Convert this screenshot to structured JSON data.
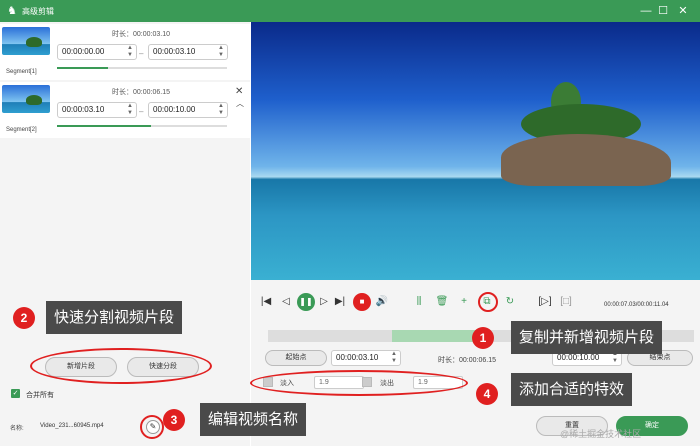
{
  "titlebar": {
    "title": "高级剪辑",
    "logo": "♞"
  },
  "window_controls": {
    "min": "—",
    "max": "☐",
    "close": "✕"
  },
  "segments": [
    {
      "label": "Segment[1]",
      "duration": "时长：00:00:03.10",
      "start": "00:00:00.00",
      "end": "00:00:03.10",
      "progress": 0.3
    },
    {
      "label": "Segment[2]",
      "duration": "时长：00:00:06.15",
      "start": "00:00:03.10",
      "end": "00:00:10.00",
      "progress": 0.55
    }
  ],
  "left_buttons": {
    "new_segment": "新增片段",
    "quick_split": "快速分段",
    "merge_all": "合并所有"
  },
  "file": {
    "name_label": "名称:",
    "name": "Video_231...60945.mp4"
  },
  "playback": {
    "time": "00:00:07.03/00:00:11.04"
  },
  "trim": {
    "start_label": "起始点",
    "start_value": "00:00:03.10",
    "duration": "时长：00:00:06.15",
    "end_value": "00:00:10.00",
    "end_label": "结束点"
  },
  "effects": {
    "fade_in": "淡入",
    "fade_in_value": "1.9",
    "fade_out": "淡出",
    "fade_out_value": "1.9"
  },
  "bottom_buttons": {
    "reset": "重置",
    "confirm": "确定"
  },
  "callouts": [
    {
      "n": "1",
      "text": "复制并新增视频片段"
    },
    {
      "n": "2",
      "text": "快速分割视频片段"
    },
    {
      "n": "3",
      "text": "编辑视频名称"
    },
    {
      "n": "4",
      "text": "添加合适的特效"
    }
  ],
  "watermark": "@稀土掘金技术社区",
  "colors": {
    "accent": "#3a9a56",
    "highlight": "#e02020"
  }
}
